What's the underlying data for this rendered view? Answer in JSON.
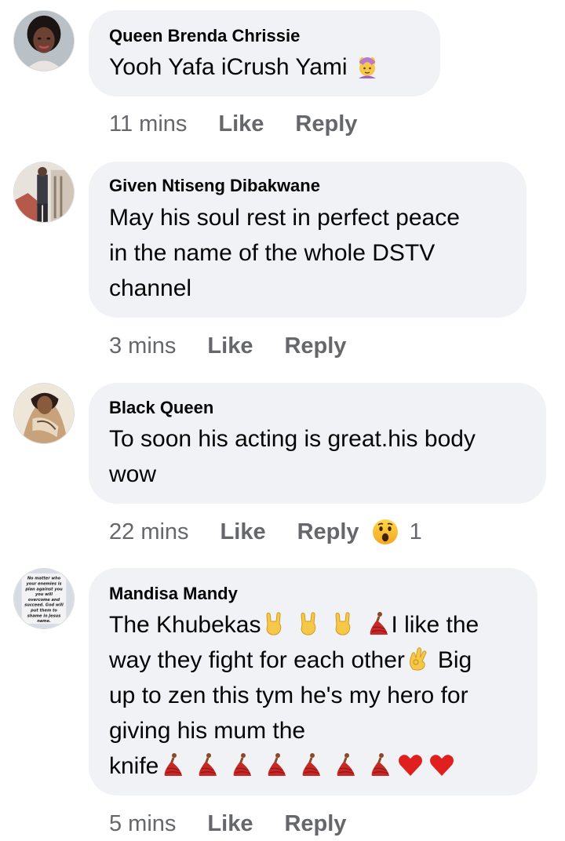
{
  "comments": [
    {
      "author": "Queen Brenda Chrissie",
      "line1": "Yooh Yafa iCrush Yami",
      "emoji": [
        "person-gesturing-ok-icon"
      ],
      "time": "11 mins",
      "like_label": "Like",
      "reply_label": "Reply"
    },
    {
      "author": "Given Ntiseng Dibakwane",
      "line1": "May his soul rest in perfect peace",
      "line2": "in the name of the whole DSTV",
      "line3": "channel",
      "time": "3 mins",
      "like_label": "Like",
      "reply_label": "Reply"
    },
    {
      "author": "Black Queen",
      "line1": "To soon his acting is great.his body",
      "line2": "wow",
      "time": "22 mins",
      "like_label": "Like",
      "reply_label": "Reply",
      "reaction_icon": "wow-reaction-icon",
      "reaction_count": "1"
    },
    {
      "author": "Mandisa Mandy",
      "line1a": "The Khubekas",
      "line1b": "I like the",
      "line2a": "way they fight for each other",
      "line2b": "Big",
      "line3": "up to zen this tym he's my hero for",
      "line4": "giving his mum the",
      "line5": "knife",
      "avatar_text": [
        "No matter who",
        "your enemies is",
        "plan against you",
        "you will",
        "overcome and",
        "succeed. God will",
        "put them to",
        "shame in Jesus",
        "name."
      ],
      "time": "5 mins",
      "like_label": "Like",
      "reply_label": "Reply"
    }
  ]
}
